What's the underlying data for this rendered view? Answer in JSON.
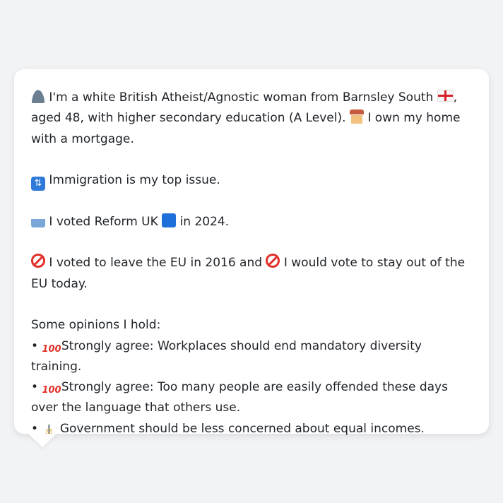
{
  "persona": {
    "intro_pre": "I'm a white British Atheist/Agnostic woman from Barnsley South",
    "intro_post": ", aged 48, with higher secondary education (A Level).",
    "home": "I own my home with a mortgage.",
    "top_issue": "Immigration is my top issue.",
    "vote_pre": "I voted Reform UK",
    "vote_post": "in 2024.",
    "eu_part1": "I voted to leave the EU in 2016 and",
    "eu_part2": "I would vote to stay out of the EU today.",
    "opinions_heading": "Some opinions I hold:",
    "opinions": [
      "Strongly agree: Workplaces should end mandatory diversity training.",
      "Strongly agree: Too many people are easily offended these days over the language that others use.",
      "Government should be less concerned about equal incomes."
    ]
  },
  "icons": {
    "person": "person-silhouette-icon",
    "flag": "england-flag-icon",
    "house": "house-icon",
    "passport": "passport-control-icon",
    "ballot": "ballot-box-icon",
    "party": "blue-square-icon",
    "no_entry": "prohibited-icon",
    "hundred": "hundred-points-icon",
    "scales": "scales-icon"
  },
  "colors": {
    "background": "#f2f3f5",
    "card": "#ffffff",
    "text": "#1f2328",
    "reform_blue": "#1e6fd9",
    "prohibited_red": "#e2312a"
  }
}
